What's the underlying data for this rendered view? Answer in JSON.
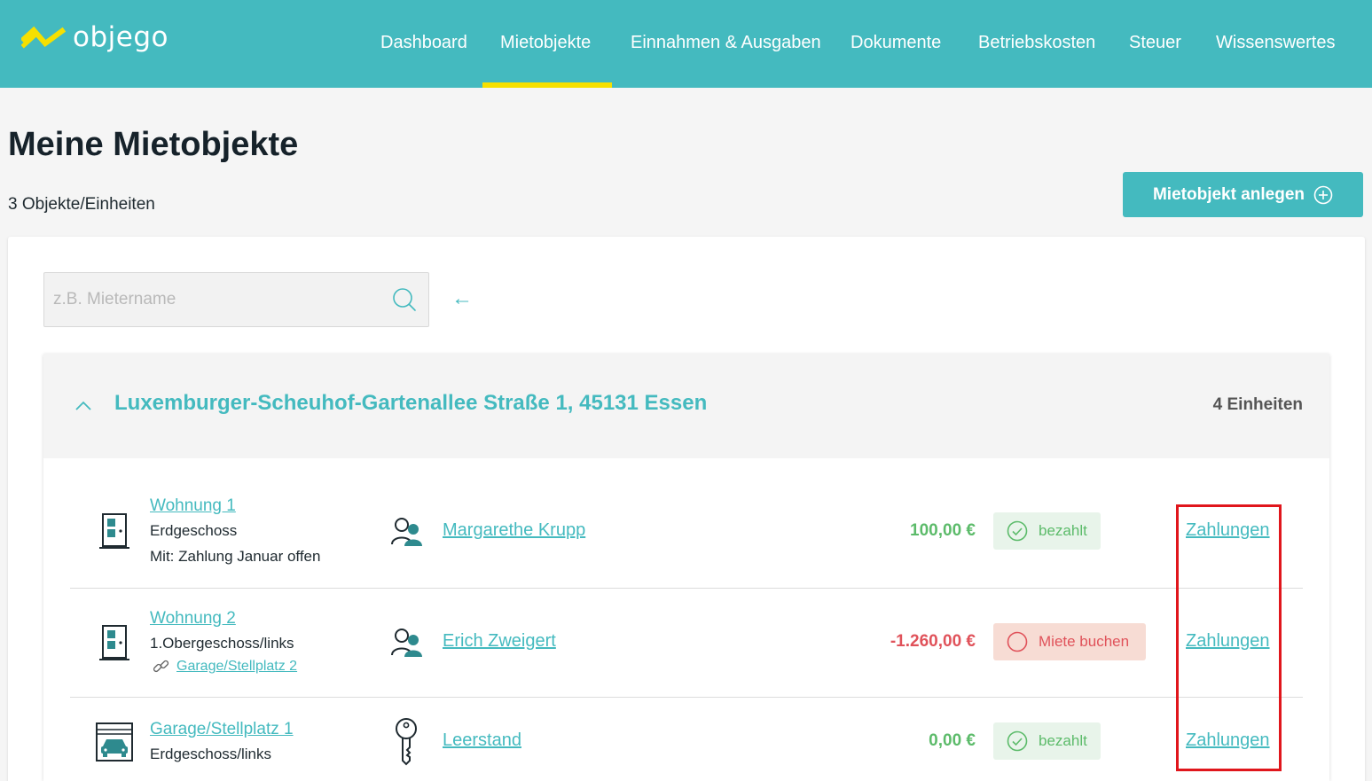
{
  "brand": {
    "name": "objego"
  },
  "nav": {
    "items": [
      "Dashboard",
      "Mietobjekte",
      "Einnahmen & Ausgaben",
      "Dokumente",
      "Betriebskosten",
      "Steuer",
      "Wissenswertes"
    ],
    "active": "Mietobjekte"
  },
  "page": {
    "title": "Meine Mietobjekte",
    "count": "3 Objekte/Einheiten",
    "add_button": "Mietobjekt anlegen"
  },
  "search": {
    "placeholder": "z.B. Mietername",
    "value": "",
    "back_arrow": "←"
  },
  "property": {
    "address": "Luxemburger-Scheuhof-Gartenallee Straße 1, 45131 Essen",
    "units_count": "4 Einheiten",
    "units": [
      {
        "icon": "apartment-door-icon",
        "name": "Wohnung 1",
        "floor": "Erdgeschoss",
        "note": "Mit: Zahlung Januar offen",
        "tenant_icon": "tenants-icon",
        "tenant": "Margarethe Krupp",
        "amount": "100,00 €",
        "status": "bezahlt",
        "status_type": "paid",
        "payments_link": "Zahlungen"
      },
      {
        "icon": "apartment-door-icon",
        "name": "Wohnung 2",
        "floor": "1.Obergeschoss/links",
        "linked_unit": "Garage/Stellplatz 2",
        "tenant_icon": "tenants-icon",
        "tenant": "Erich Zweigert",
        "amount": "-1.260,00 €",
        "status": "Miete buchen",
        "status_type": "due",
        "payments_link": "Zahlungen"
      },
      {
        "icon": "garage-icon",
        "name": "Garage/Stellplatz 1",
        "floor": "Erdgeschoss/links",
        "tenant_icon": "key-icon",
        "tenant": "Leerstand",
        "amount": "0,00 €",
        "status": "bezahlt",
        "status_type": "paid",
        "payments_link": "Zahlungen"
      }
    ]
  },
  "colors": {
    "brand_teal": "#44babf",
    "nav_active_underline": "#f6e000",
    "paid_green": "#5cbb6a",
    "due_red": "#e0525a",
    "highlight_red": "#e0161c"
  }
}
